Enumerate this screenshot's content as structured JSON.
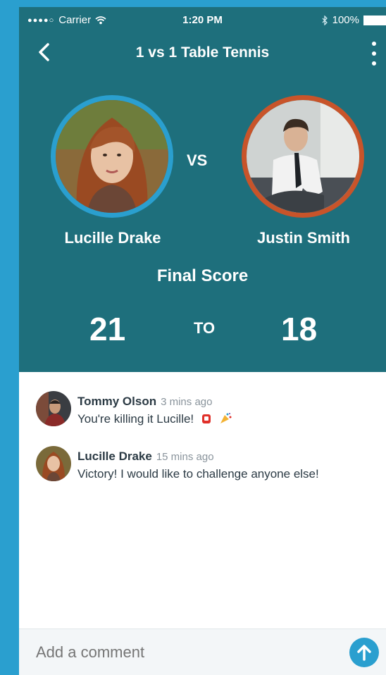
{
  "status_bar": {
    "carrier": "Carrier",
    "time": "1:20 PM",
    "battery": "100%"
  },
  "header": {
    "title": "1 vs 1 Table Tennis"
  },
  "match": {
    "vs_label": "VS",
    "player_left": "Lucille Drake",
    "player_right": "Justin Smith",
    "final_label": "Final Score",
    "score_left": "21",
    "to_label": "TO",
    "score_right": "18",
    "colors": {
      "left_ring": "#2a9fcf",
      "right_ring": "#c8542a",
      "hero_bg": "#1e6f7c"
    }
  },
  "comments": [
    {
      "author": "Tommy Olson",
      "time": "3 mins ago",
      "text": "You're killing it Lucille!"
    },
    {
      "author": "Lucille Drake",
      "time": "15 mins ago",
      "text": "Victory! I would like to challenge anyone else!"
    }
  ],
  "composer": {
    "placeholder": "Add a comment"
  }
}
